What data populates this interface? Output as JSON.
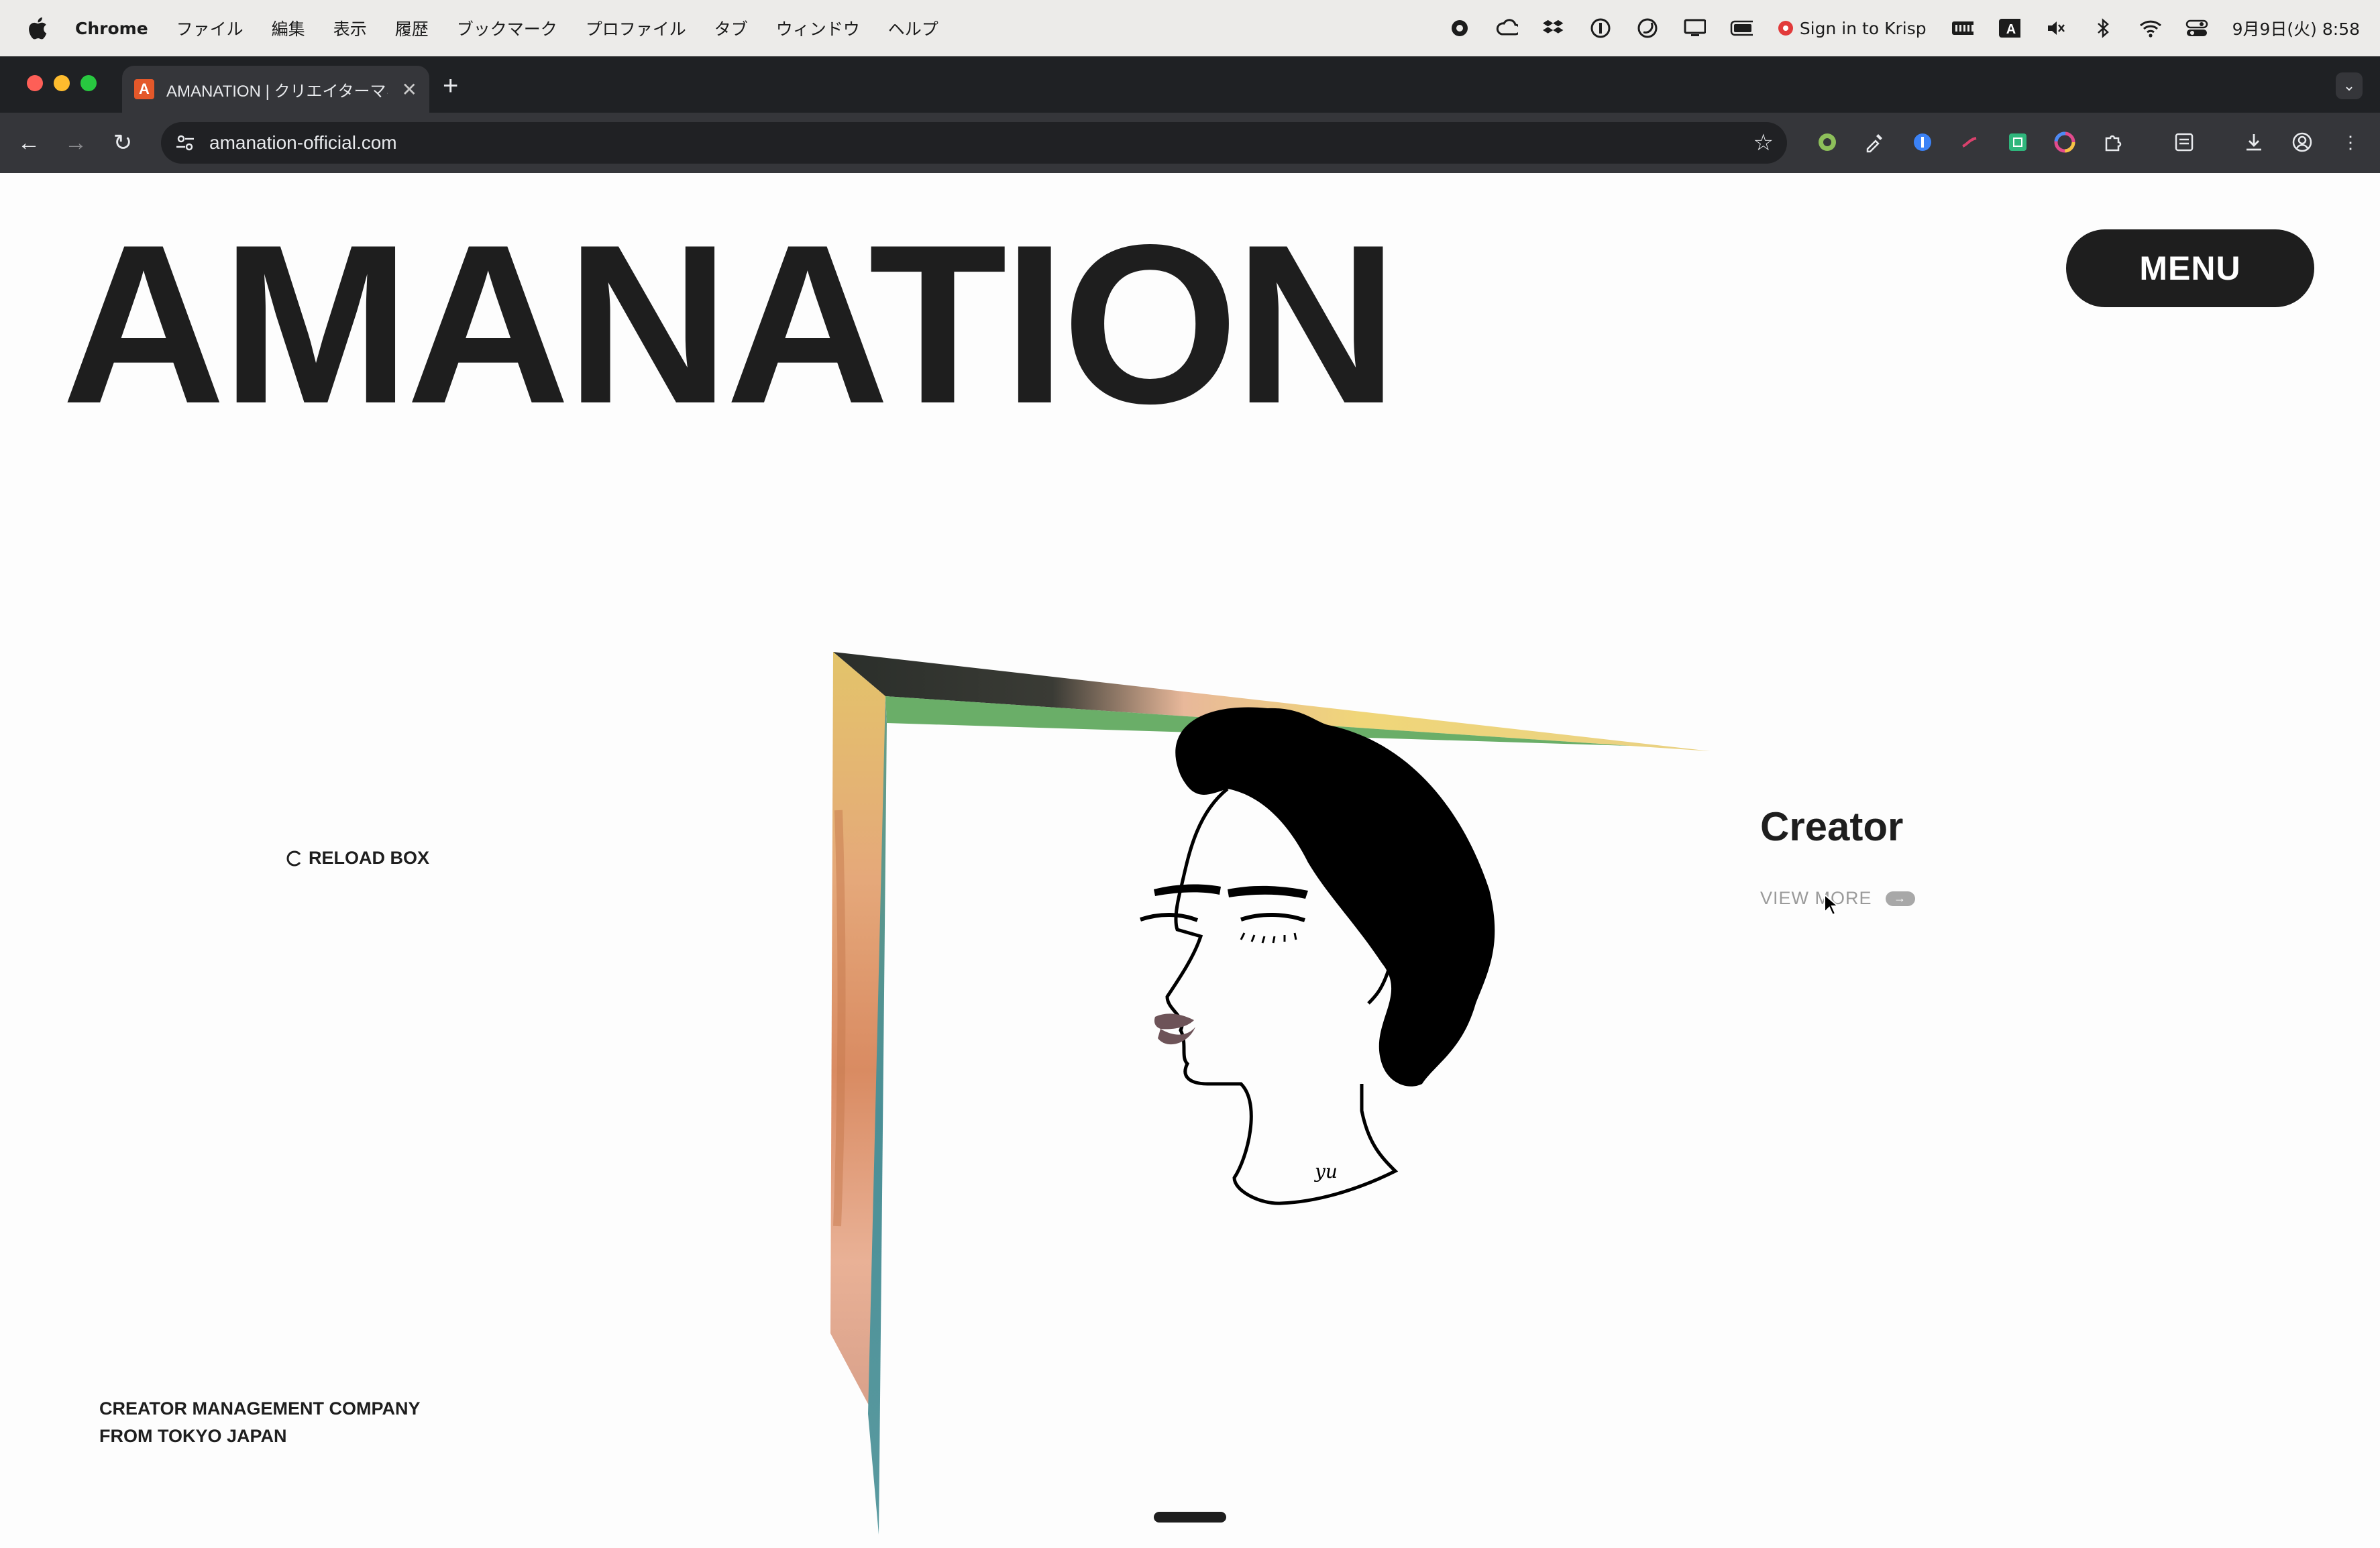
{
  "menubar": {
    "app": "Chrome",
    "items": [
      "ファイル",
      "編集",
      "表示",
      "履歴",
      "ブックマーク",
      "プロファイル",
      "タブ",
      "ウィンドウ",
      "ヘルプ"
    ],
    "krisp": "Sign in to Krisp",
    "clock": "9月9日(火) 8:58",
    "input_source": "A"
  },
  "browser": {
    "tab_title": "AMANATION | クリエイターマネ",
    "favicon_letter": "A",
    "url": "amanation-official.com"
  },
  "page": {
    "brand": "AMANATION",
    "menu_label": "MENU",
    "reload_label": "RELOAD BOX",
    "company_line1": "CREATOR MANAGEMENT COMPANY",
    "company_line2": "FROM TOKYO JAPAN",
    "creator_title": "Creator",
    "view_more": "VIEW MORE",
    "signature": "yu"
  },
  "colors": {
    "accent_dark": "#1e1e1e",
    "favicon": "#e4582a",
    "box_green": "#6aae68",
    "box_yellow": "#f0d679",
    "box_teal": "#4a8f96",
    "lips": "#6d5358"
  }
}
